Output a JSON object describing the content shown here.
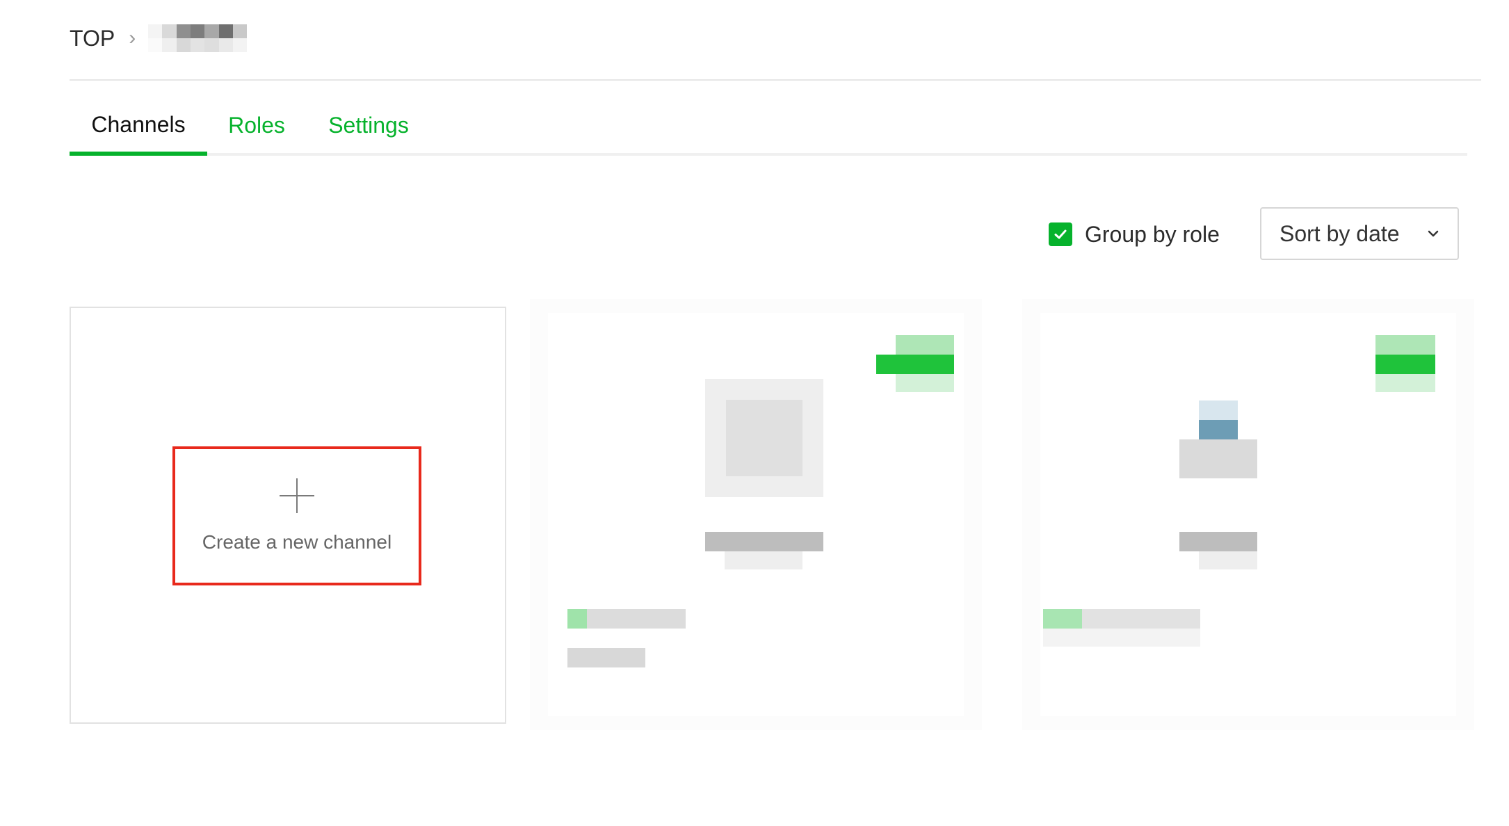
{
  "breadcrumb": {
    "root": "TOP",
    "separator": "›"
  },
  "tabs": [
    {
      "label": "Channels",
      "active": true
    },
    {
      "label": "Roles",
      "active": false
    },
    {
      "label": "Settings",
      "active": false
    }
  ],
  "controls": {
    "group_by_role": {
      "label": "Group by role",
      "checked": true
    },
    "sort": {
      "selected": "Sort by date"
    }
  },
  "create_card": {
    "label": "Create a new channel"
  },
  "colors": {
    "accent": "#06b22c",
    "highlight_border": "#e8291c"
  },
  "icons": {
    "plus": "plus-icon",
    "chevron": "chevron-down-icon",
    "check": "check-icon"
  }
}
